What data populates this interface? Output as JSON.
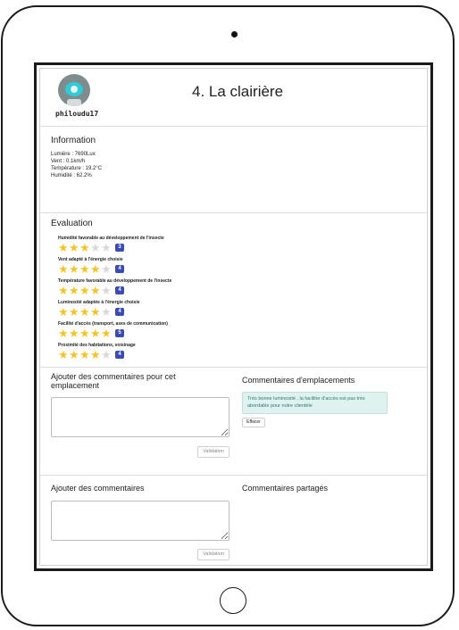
{
  "user": {
    "username": "philoudu17"
  },
  "page": {
    "title": "4. La clairière"
  },
  "information": {
    "title": "Information",
    "lines": [
      "Lumière : 7690Lux",
      "Vent : 0.1km/h",
      "Température : 19.2°C",
      "Humidité : 62.2%"
    ]
  },
  "evaluation": {
    "title": "Evaluation",
    "criteria": [
      {
        "label": "Humidité favorable au développement de l'insecte",
        "score": "3",
        "rating": 3
      },
      {
        "label": "Vent adapté à l'énergie choisie",
        "score": "4",
        "rating": 4
      },
      {
        "label": "Température favorable au développement de l'insecte",
        "score": "4",
        "rating": 4
      },
      {
        "label": "Luminosité adaptée à l'énergie choisie",
        "score": "4",
        "rating": 4
      },
      {
        "label": "Facilité d'accès (transport, axes de communication)",
        "score": "5",
        "rating": 5
      },
      {
        "label": "Proximité des habitations, voisinage",
        "score": "4",
        "rating": 4
      }
    ]
  },
  "location_comments": {
    "add_title": "Ajouter des commentaires pour cet emplacement",
    "textarea_value": "",
    "validate_label": "Validation",
    "list_title": "Commentaires d'emplacements",
    "comment_text": "Très bonne luminosité , la faciliter d'accès est pas très abordable pour notre clientèle",
    "erase_label": "Effacer"
  },
  "shared_comments": {
    "add_title": "Ajouter des commentaires",
    "textarea_value": "",
    "validate_label": "Validation",
    "list_title": "Commentaires partagés"
  },
  "colors": {
    "star_on": "#f2c52b",
    "star_off": "#d9d9d9",
    "badge": "#3a4bb2",
    "comment_bg": "#dff2ef",
    "comment_text": "#2d7a68"
  }
}
